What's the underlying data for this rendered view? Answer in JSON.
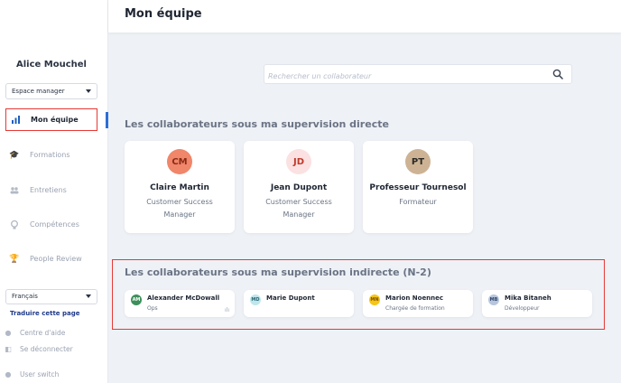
{
  "header": {
    "title": "Mon équipe"
  },
  "sidebar": {
    "user_name": "Alice Mouchel",
    "space_select": "Espace manager",
    "items": [
      {
        "label": "Mon équipe",
        "icon": "bar-chart-icon"
      },
      {
        "label": "Formations",
        "icon": "graduation-cap-icon"
      },
      {
        "label": "Entretiens",
        "icon": "people-icon"
      },
      {
        "label": "Compétences",
        "icon": "lightbulb-icon"
      },
      {
        "label": "People Review",
        "icon": "trophy-icon"
      }
    ],
    "language_select": "Français",
    "translate_link": "Traduire cette page",
    "footer": [
      {
        "label": "Centre d'aide",
        "icon": "help-icon"
      },
      {
        "label": "Se déconnecter",
        "icon": "logout-icon"
      },
      {
        "label": "User switch",
        "icon": "switch-user-icon"
      }
    ]
  },
  "search": {
    "placeholder": "Rechercher un collaborateur"
  },
  "direct": {
    "title": "Les collaborateurs sous ma supervision directe",
    "people": [
      {
        "initials": "CM",
        "name": "Claire Martin",
        "role": "Customer Success Manager",
        "color": "#f0866a",
        "text_color": "#8a2b16"
      },
      {
        "initials": "JD",
        "name": "Jean Dupont",
        "role": "Customer Success Manager",
        "color": "#fbe1e1",
        "text_color": "#c0392b"
      },
      {
        "initials": "PT",
        "name": "Professeur Tournesol",
        "role": "Formateur",
        "color": "#cdb394",
        "text_color": "#2b2a26"
      }
    ]
  },
  "indirect": {
    "title": "Les collaborateurs sous ma supervision indirecte (N-2)",
    "people": [
      {
        "initials": "AM",
        "name": "Alexander McDowall",
        "role": "Ops",
        "color": "#3c8f5a",
        "text_color": "#ffffff",
        "stat": "ılı"
      },
      {
        "initials": "MD",
        "name": "Marie Dupont",
        "role": "",
        "color": "#bfe6ec",
        "text_color": "#2a6470"
      },
      {
        "initials": "MN",
        "name": "Marion Noennec",
        "role": "Chargée de formation",
        "color": "#f5c518",
        "text_color": "#7a4f00"
      },
      {
        "initials": "MB",
        "name": "Mika Bitaneh",
        "role": "Développeur",
        "color": "#b6c6de",
        "text_color": "#2f4566"
      }
    ]
  },
  "colors": {
    "accent": "#2a6fd6",
    "highlight": "#e53935",
    "background": "#eef1f6"
  }
}
